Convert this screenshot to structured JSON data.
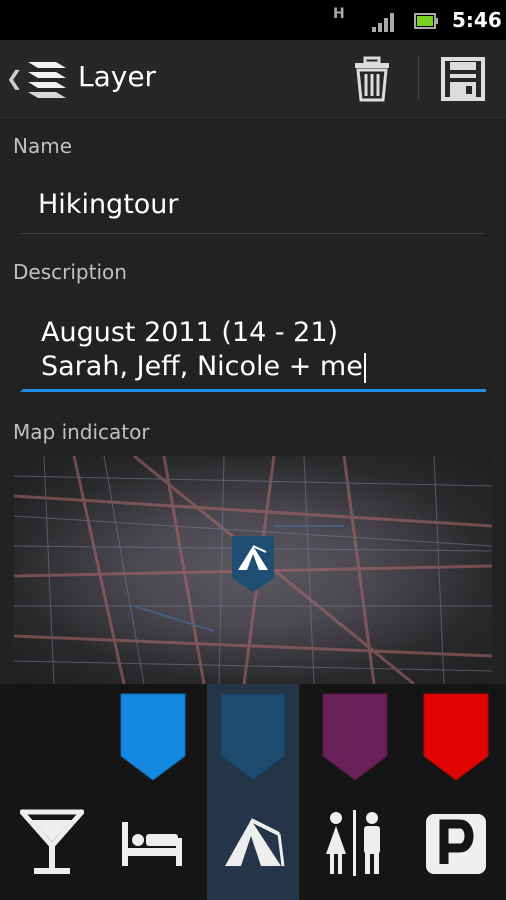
{
  "status_bar": {
    "network_letter": "H",
    "time": "5:46",
    "icons": [
      "signal-icon",
      "battery-icon"
    ]
  },
  "action_bar": {
    "title": "Layer",
    "icons": [
      "back-chevron-icon",
      "layers-icon",
      "trash-icon",
      "save-icon"
    ]
  },
  "form": {
    "name_label": "Name",
    "name_value": "Hikingtour",
    "description_label": "Description",
    "description_lines": [
      "August 2011 (14 - 21)",
      "Sarah, Jeff, Nicole + me"
    ],
    "map_label": "Map indicator"
  },
  "map_preview": {
    "marker_icon": "tent-icon",
    "marker_color": "#1e4f73"
  },
  "color_options": [
    {
      "name": "blue",
      "color": "#1589e0",
      "selected": false
    },
    {
      "name": "dark-blue",
      "color": "#1e4a6e",
      "selected": true
    },
    {
      "name": "purple",
      "color": "#6a2159",
      "selected": false
    },
    {
      "name": "red",
      "color": "#e00505",
      "selected": false
    }
  ],
  "icon_options": [
    {
      "name": "cocktail-icon",
      "selected": false
    },
    {
      "name": "bed-icon",
      "selected": false
    },
    {
      "name": "tent-icon",
      "selected": true
    },
    {
      "name": "restroom-icon",
      "selected": false
    },
    {
      "name": "parking-icon",
      "selected": false
    }
  ],
  "accent_color": "#1f8ee6"
}
